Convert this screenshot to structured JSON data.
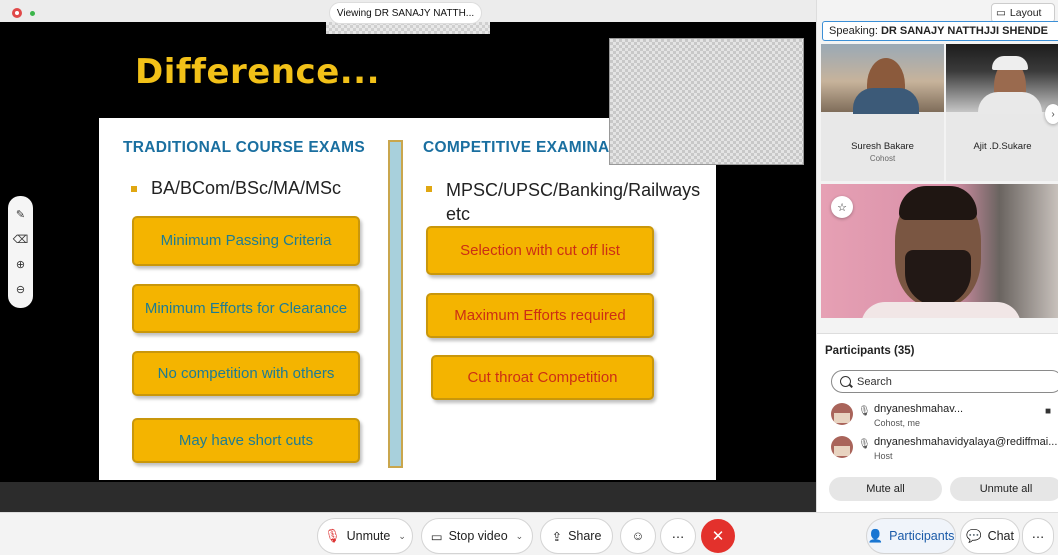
{
  "share": {
    "viewing_label": "Viewing DR SANAJY NATTH...",
    "slide": {
      "title": "Difference...",
      "left": {
        "heading": "TRADITIONAL COURSE  EXAMS",
        "bullet": "BA/BCom/BSc/MA/MSc",
        "boxes": [
          "Minimum Passing Criteria",
          "Minimum Efforts for Clearance",
          "No competition with others",
          "May have short cuts"
        ]
      },
      "right": {
        "heading": "COMPETITIVE EXAMINA",
        "bullet": "MPSC/UPSC/Banking/Railways etc",
        "boxes": [
          "Selection with cut off list",
          "Maximum Efforts required",
          "Cut throat Competition"
        ]
      },
      "colors": {
        "title": "#f2c118",
        "heading": "#1a6fa0",
        "box_fill": "#f4b400",
        "left_text": "#1d7c94",
        "right_text": "#cc2f14"
      }
    },
    "annotation_tools": [
      "pen-icon",
      "eraser-icon",
      "zoom-in-icon",
      "zoom-out-icon"
    ]
  },
  "sidebar": {
    "layout_label": "Layout",
    "speaking_label": "Speaking:",
    "speaking_name": "DR SANAJY NATTHJJI SHENDE",
    "tiles": [
      {
        "name": "Suresh Bakare",
        "role": "Cohost"
      },
      {
        "name": "Ajit .D.Sukare",
        "role": ""
      }
    ],
    "participants": {
      "title": "Participants (35)",
      "search_placeholder": "Search",
      "list": [
        {
          "name": "dnyaneshmahav...",
          "role": "Cohost, me"
        },
        {
          "name": "dnyaneshmahavidyalaya@rediffmai...",
          "role": "Host"
        }
      ],
      "mute_all": "Mute all",
      "unmute_all": "Unmute all"
    }
  },
  "controls": {
    "unmute": "Unmute",
    "stop_video": "Stop video",
    "share": "Share",
    "participants": "Participants",
    "chat": "Chat",
    "colors": {
      "leave": "#e3312c",
      "active": "#1a5aa8"
    }
  }
}
